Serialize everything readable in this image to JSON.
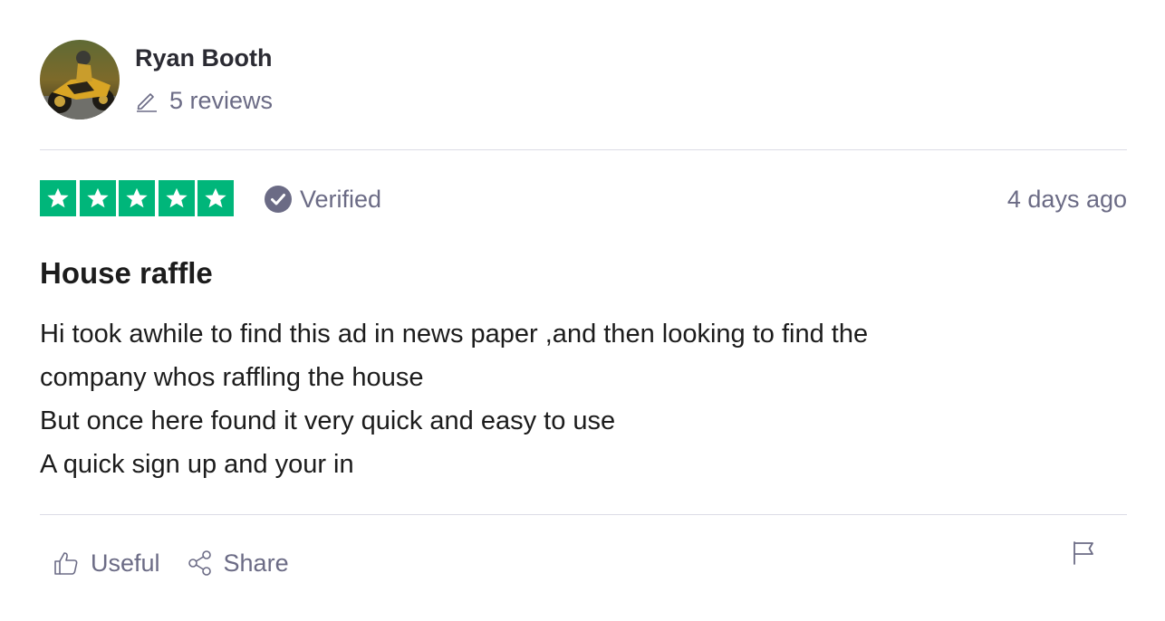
{
  "consumer": {
    "name": "Ryan Booth",
    "reviews_label": "5 reviews"
  },
  "rating": {
    "stars": 5,
    "star_color": "#00b67a",
    "verified_label": "Verified",
    "date": "4 days ago"
  },
  "review": {
    "title": "House raffle",
    "body_lines": [
      "Hi took awhile to find this ad in news paper ,and then looking to find the",
      "company whos raffling the house",
      "But once here found it very quick and easy to use",
      "A quick sign up and your in"
    ]
  },
  "actions": {
    "useful_label": "Useful",
    "share_label": "Share"
  }
}
